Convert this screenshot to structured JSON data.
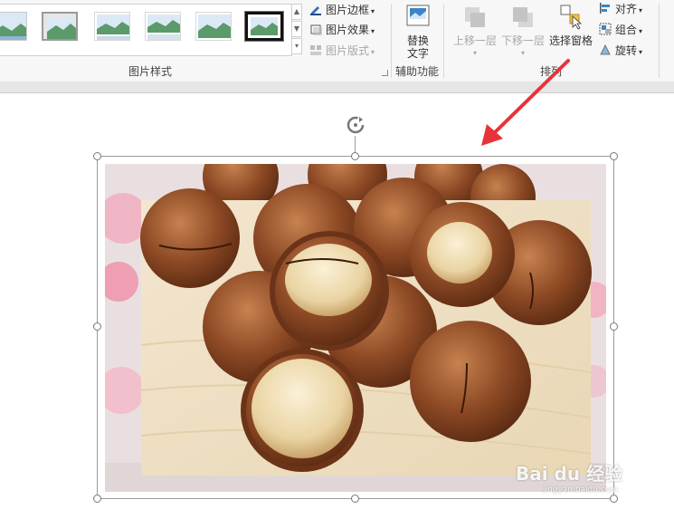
{
  "ribbon": {
    "picture_styles": {
      "group_label": "图片样式",
      "border_label": "图片边框",
      "effects_label": "图片效果",
      "layout_label": "图片版式"
    },
    "accessibility": {
      "group_label": "辅助功能",
      "alt_text_line1": "替换",
      "alt_text_line2": "文字"
    },
    "arrange": {
      "group_label": "排列",
      "bring_forward_label": "上移一层",
      "send_backward_label": "下移一层",
      "selection_pane_label": "选择窗格",
      "align_label": "对齐",
      "group_label_cmd": "组合",
      "rotate_label": "旋转"
    }
  },
  "watermark": {
    "brand": "Bai du 经验",
    "url": "jingyan.baidu.com"
  },
  "colors": {
    "annotation_arrow": "#e8333a",
    "selection_border": "#9a9a9a"
  }
}
